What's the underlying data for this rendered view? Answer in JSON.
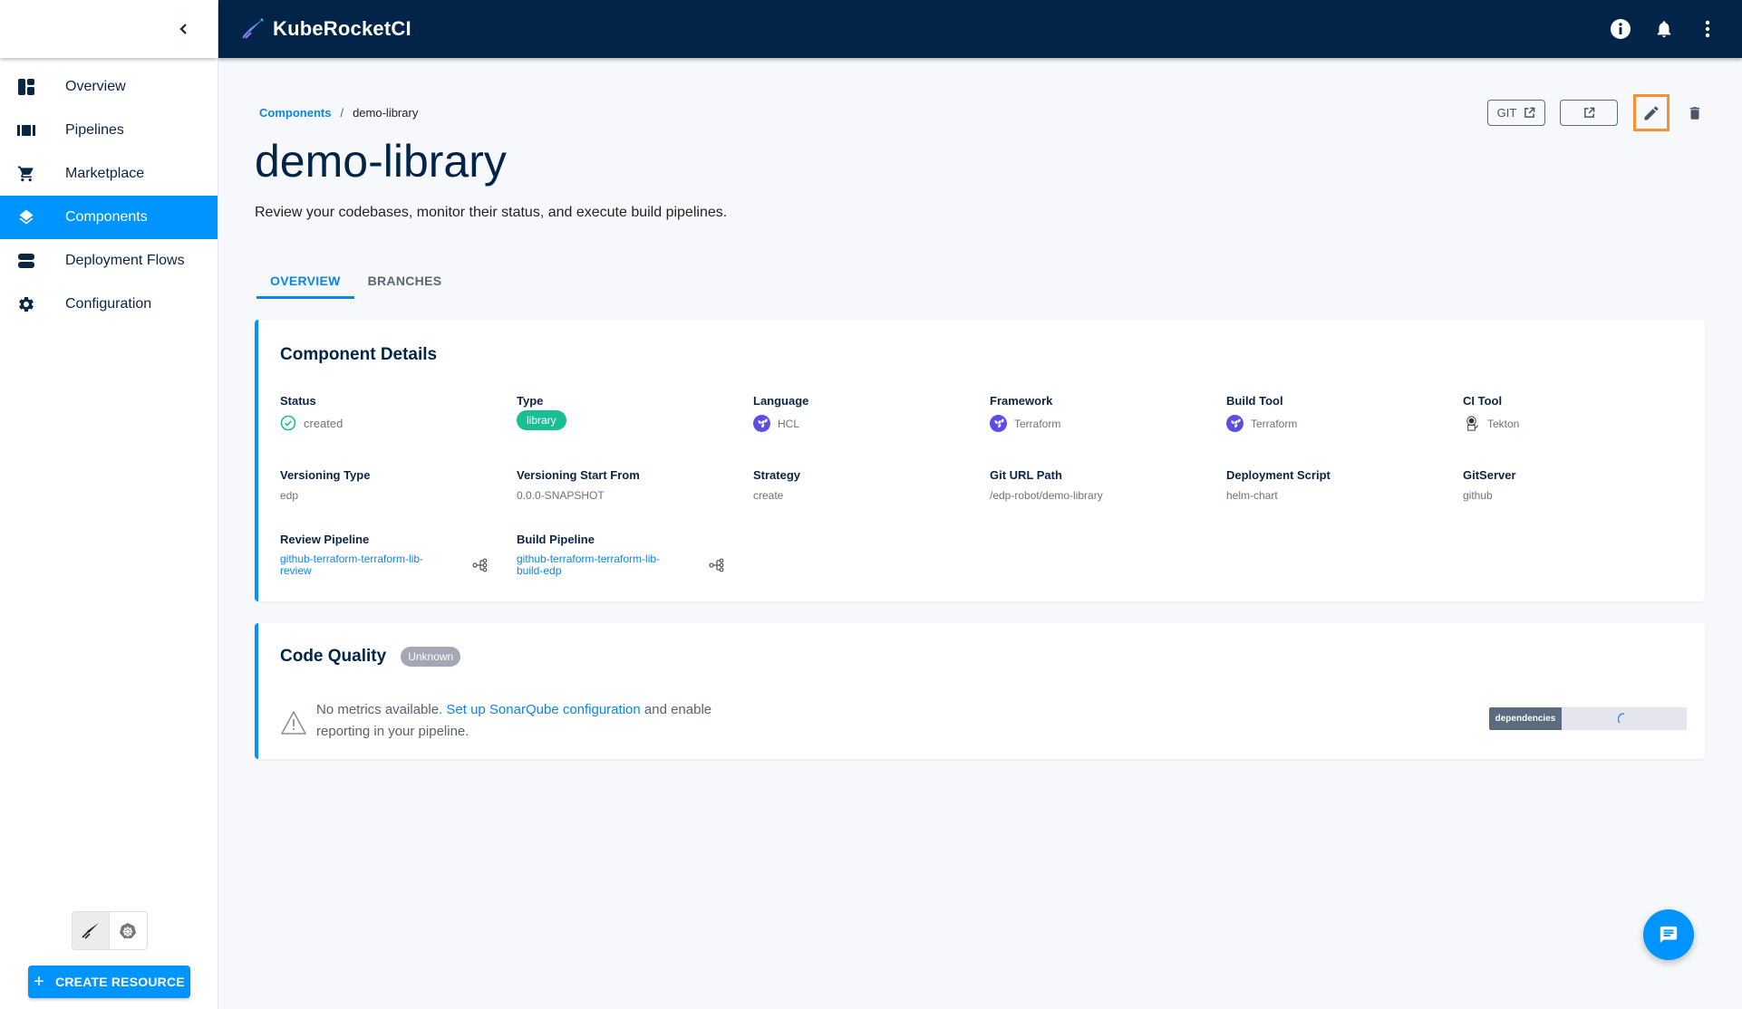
{
  "app": {
    "title": "KubeRocketCI"
  },
  "header": {
    "icons": [
      "info-icon",
      "notifications-bell-icon",
      "more-vertical-icon"
    ]
  },
  "sidebar": {
    "items": [
      {
        "label": "Overview",
        "icon": "dashboard-icon",
        "active": false
      },
      {
        "label": "Pipelines",
        "icon": "pipelines-icon",
        "active": false
      },
      {
        "label": "Marketplace",
        "icon": "cart-icon",
        "active": false
      },
      {
        "label": "Components",
        "icon": "layers-icon",
        "active": true
      },
      {
        "label": "Deployment Flows",
        "icon": "deployment-flows-icon",
        "active": false
      },
      {
        "label": "Configuration",
        "icon": "gear-icon",
        "active": false
      }
    ],
    "mode_toggle": [
      "kuberocketci-mode",
      "kubernetes-mode"
    ],
    "create_resource_label": "CREATE RESOURCE"
  },
  "breadcrumb": {
    "parent": "Components",
    "separator": "/",
    "current": "demo-library"
  },
  "page": {
    "title": "demo-library",
    "subtitle": "Review your codebases, monitor their status, and execute build pipelines.",
    "actions": {
      "git_label": "GIT"
    }
  },
  "tabs": [
    {
      "label": "OVERVIEW",
      "active": true
    },
    {
      "label": "BRANCHES",
      "active": false
    }
  ],
  "details": {
    "title": "Component Details",
    "status": {
      "label": "Status",
      "value": "created"
    },
    "type": {
      "label": "Type",
      "value": "library"
    },
    "language": {
      "label": "Language",
      "value": "HCL"
    },
    "framework": {
      "label": "Framework",
      "value": "Terraform"
    },
    "build_tool": {
      "label": "Build Tool",
      "value": "Terraform"
    },
    "ci_tool": {
      "label": "CI Tool",
      "value": "Tekton"
    },
    "versioning_type": {
      "label": "Versioning Type",
      "value": "edp"
    },
    "versioning_start": {
      "label": "Versioning Start From",
      "value": "0.0.0-SNAPSHOT"
    },
    "strategy": {
      "label": "Strategy",
      "value": "create"
    },
    "git_url_path": {
      "label": "Git URL Path",
      "value": "/edp-robot/demo-library"
    },
    "deployment_script": {
      "label": "Deployment Script",
      "value": "helm-chart"
    },
    "git_server": {
      "label": "GitServer",
      "value": "github"
    },
    "review_pipeline": {
      "label": "Review Pipeline",
      "value": "github-terraform-terraform-lib-review"
    },
    "build_pipeline": {
      "label": "Build Pipeline",
      "value": "github-terraform-terraform-lib-build-edp"
    }
  },
  "code_quality": {
    "title": "Code Quality",
    "badge": "Unknown",
    "message_prefix": "No metrics available. ",
    "link_text": "Set up SonarQube configuration",
    "message_suffix": " and enable reporting in your pipeline.",
    "dependencies_label": "dependencies"
  },
  "colors": {
    "accent": "#0094ff",
    "header_bg": "#022448",
    "chip_library": "#18be94",
    "edit_highlight": "#f7922e"
  }
}
